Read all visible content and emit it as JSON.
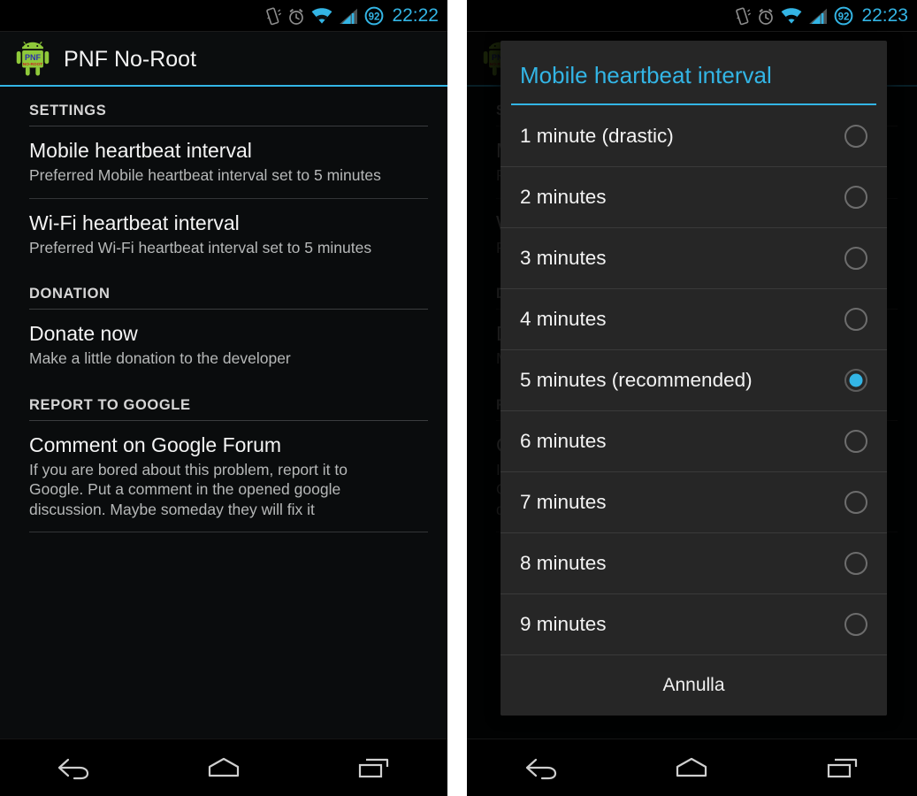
{
  "left_phone": {
    "status_bar": {
      "time": "22:22",
      "battery_level": "92",
      "icons": [
        "vibrate-icon",
        "alarm-clock-icon",
        "wifi-icon",
        "cellular-signal-icon",
        "battery-icon"
      ],
      "accent_color": "#33b5e5"
    },
    "action_bar": {
      "app_icon": "android-pnf-app-icon",
      "title": "PNF No-Root",
      "underline_color": "#33b5e5"
    },
    "sections": [
      {
        "header": "SETTINGS",
        "items": [
          {
            "title": "Mobile heartbeat interval",
            "summary": "Preferred Mobile heartbeat interval set to 5 minutes"
          },
          {
            "title": "Wi-Fi heartbeat interval",
            "summary": "Preferred Wi-Fi heartbeat interval set to 5 minutes"
          }
        ]
      },
      {
        "header": "DONATION",
        "items": [
          {
            "title": "Donate now",
            "summary": "Make a little donation to the developer"
          }
        ]
      },
      {
        "header": "REPORT TO GOOGLE",
        "items": [
          {
            "title": "Comment on Google Forum",
            "summary": "If you are bored about this problem, report it to Google. Put a comment in the opened google discussion. Maybe someday they will fix it"
          }
        ]
      }
    ]
  },
  "right_phone": {
    "status_bar": {
      "time": "22:23",
      "battery_level": "92"
    },
    "dialog": {
      "title": "Mobile heartbeat interval",
      "title_color": "#33b5e5",
      "selected_index": 4,
      "options": [
        "1 minute (drastic)",
        "2 minutes",
        "3 minutes",
        "4 minutes",
        "5 minutes (recommended)",
        "6 minutes",
        "7 minutes",
        "8 minutes",
        "9 minutes"
      ],
      "cancel_label": "Annulla"
    }
  },
  "nav_bar": {
    "back": "back-icon",
    "home": "home-icon",
    "recents": "recent-apps-icon"
  }
}
